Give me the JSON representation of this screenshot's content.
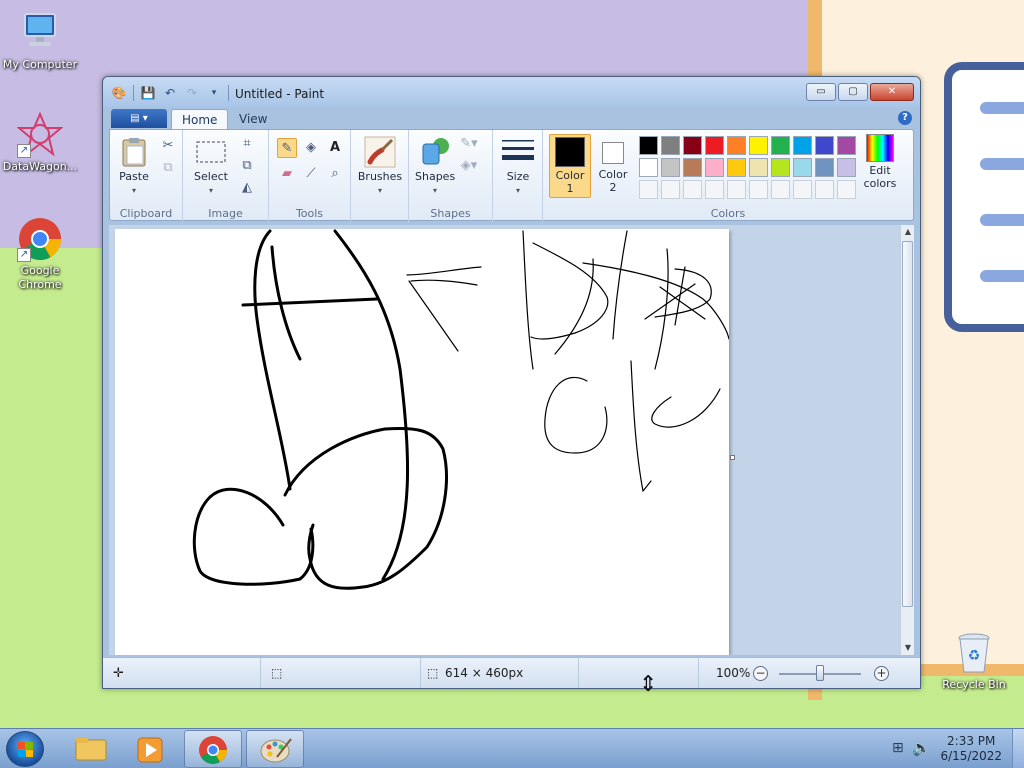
{
  "desktop": {
    "icons": [
      {
        "label": "My Computer"
      },
      {
        "label": "DataWagon..."
      },
      {
        "label": "Google Chrome"
      },
      {
        "label": "Recycle Bin"
      }
    ]
  },
  "window": {
    "title": "Untitled - Paint",
    "controls": {
      "minimize": "▭",
      "maximize": "▢",
      "close": "✕"
    }
  },
  "ribbon": {
    "tabs": [
      {
        "label": "Home",
        "active": true
      },
      {
        "label": "View",
        "active": false
      }
    ],
    "groups": {
      "clipboard": {
        "label": "Clipboard",
        "paste": "Paste"
      },
      "image": {
        "label": "Image",
        "select": "Select"
      },
      "tools": {
        "label": "Tools"
      },
      "brushes": {
        "label": "Brushes"
      },
      "shapes": {
        "label": "Shapes",
        "shapes_button": "Shapes"
      },
      "size": {
        "label": "Size"
      },
      "colors": {
        "label": "Colors",
        "color1": "Color 1",
        "color2": "Color 2",
        "edit": "Edit colors",
        "color1_value": "#000000",
        "color2_value": "#ffffff",
        "palette_row1": [
          "#000000",
          "#7f7f7f",
          "#880015",
          "#ed1c24",
          "#ff7f27",
          "#fff200",
          "#22b14c",
          "#00a2e8",
          "#3f48cc",
          "#a349a4"
        ],
        "palette_row2": [
          "#ffffff",
          "#c3c3c3",
          "#b97a57",
          "#ffaec9",
          "#ffc90e",
          "#efe4b0",
          "#b5e61d",
          "#99d9ea",
          "#7092be",
          "#c8bfe7"
        ]
      }
    }
  },
  "statusbar": {
    "image_size": "614 × 460px",
    "zoom": "100%"
  },
  "taskbar": {
    "time": "2:33 PM",
    "date": "6/15/2022"
  }
}
